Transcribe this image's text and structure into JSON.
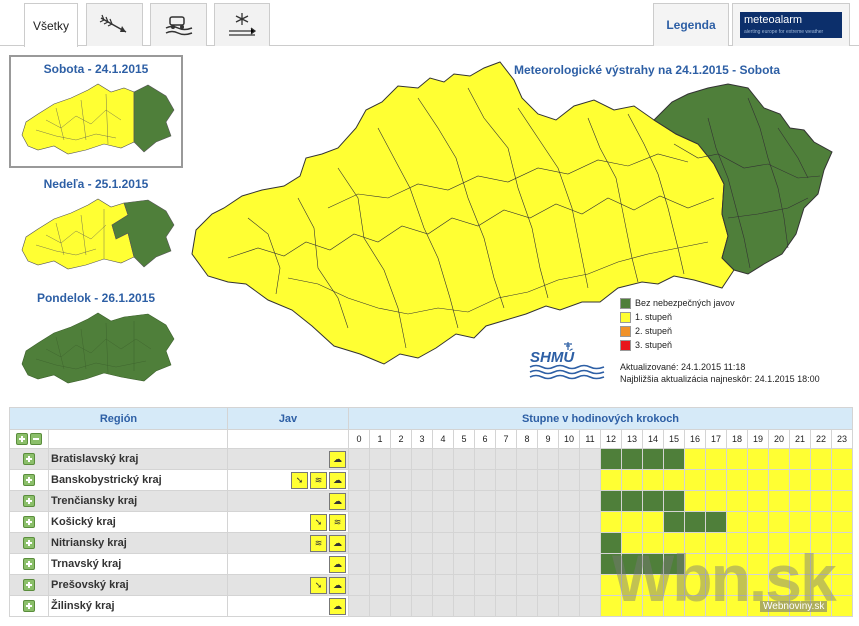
{
  "tabs": [
    {
      "label": "Všetky",
      "icon": ""
    },
    {
      "label": "",
      "icon": "wind-icon"
    },
    {
      "label": "",
      "icon": "fog-icon"
    },
    {
      "label": "",
      "icon": "snow-icon"
    }
  ],
  "legend_tab_label": "Legenda",
  "meteoalarm": {
    "brand": "meteoalarm",
    "tagline": "alerting europe for extreme weather"
  },
  "days": [
    {
      "title": "Sobota - 24.1.2015"
    },
    {
      "title": "Nedeľa - 25.1.2015"
    },
    {
      "title": "Pondelok - 26.1.2015"
    }
  ],
  "main_title": "Meteorologické výstrahy na 24.1.2015 - Sobota",
  "legend": [
    {
      "label": "Bez nebezpečných javov",
      "color": "#4f7f3a"
    },
    {
      "label": "1. stupeň",
      "color": "#ffff33"
    },
    {
      "label": "2. stupeň",
      "color": "#f0922b"
    },
    {
      "label": "3. stupeň",
      "color": "#e8161b"
    }
  ],
  "shmu_label": "SHMÚ",
  "updated": "Aktualizované: 24.1.2015 11:18",
  "next_update": "Najbližšia aktualizácia najneskôr: 24.1.2015 18:00",
  "table": {
    "col_region": "Región",
    "col_jav": "Jav",
    "col_hours": "Stupne v hodinových krokoch",
    "hours": [
      "0",
      "1",
      "2",
      "3",
      "4",
      "5",
      "6",
      "7",
      "8",
      "9",
      "10",
      "11",
      "12",
      "13",
      "14",
      "15",
      "16",
      "17",
      "18",
      "19",
      "20",
      "21",
      "22",
      "23"
    ],
    "rows": [
      {
        "name": "Bratislavský kraj",
        "icons": [
          "fog-icon"
        ],
        "cells": "EEEEEEEEEEEEGGGGYYYYYYYY"
      },
      {
        "name": "Banskobystrický kraj",
        "icons": [
          "wind-icon",
          "snow-drift-icon",
          "fog-icon"
        ],
        "cells": "EEEEEEEEEEEEYYYYYYYYYYYY"
      },
      {
        "name": "Trenčiansky kraj",
        "icons": [
          "fog-icon"
        ],
        "cells": "EEEEEEEEEEEEGGGGYYYYYYYY"
      },
      {
        "name": "Košický kraj",
        "icons": [
          "wind-icon",
          "snow-drift-icon"
        ],
        "cells": "EEEEEEEEEEEEYYYGGGYYYYYY"
      },
      {
        "name": "Nitriansky kraj",
        "icons": [
          "snow-drift-icon",
          "fog-icon"
        ],
        "cells": "EEEEEEEEEEEEGYYYYYYYYYYY"
      },
      {
        "name": "Trnavský kraj",
        "icons": [
          "fog-icon"
        ],
        "cells": "EEEEEEEEEEEEGGGGYYYYYYYY"
      },
      {
        "name": "Prešovský kraj",
        "icons": [
          "wind-icon",
          "fog-icon"
        ],
        "cells": "EEEEEEEEEEEEYYYYYYYYYYYY"
      },
      {
        "name": "Žilinský kraj",
        "icons": [
          "fog-icon"
        ],
        "cells": "EEEEEEEEEEEEYYYYYYYYYYYY"
      }
    ]
  },
  "watermark": "Wbn.sk",
  "watermark_sub": "Webnoviny.sk"
}
